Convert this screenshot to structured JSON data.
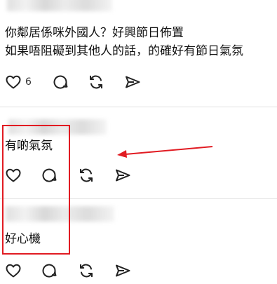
{
  "posts": [
    {
      "lines": [
        "你鄰居係咪外國人？好興節日佈置",
        "如果唔阻礙到其他人的話，的確好有節日氣氛"
      ],
      "like_count": "6"
    },
    {
      "text": "有啲氣氛"
    },
    {
      "text": "好心機"
    }
  ],
  "icons": {
    "like": "heart-icon",
    "reply": "speech-bubble-icon",
    "repost": "repost-icon",
    "share": "send-icon"
  },
  "colors": {
    "annotation_red": "#e11b22"
  }
}
